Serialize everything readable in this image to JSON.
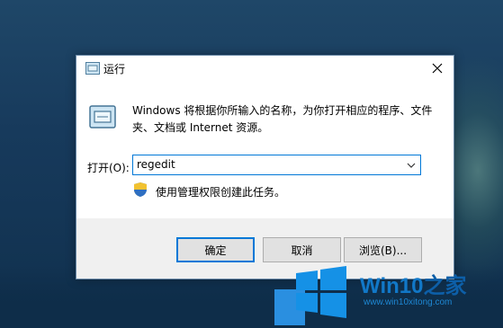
{
  "window": {
    "title": "运行",
    "description": "Windows 将根据你所输入的名称，为你打开相应的程序、文件夹、文档或 Internet 资源。",
    "open_label": "打开(O):",
    "open_value": "regedit",
    "admin_note": "使用管理权限创建此任务。"
  },
  "buttons": {
    "ok": "确定",
    "cancel": "取消",
    "browse": "浏览(B)..."
  },
  "watermark": {
    "brand_prefix": "Win10",
    "brand_suffix": "之家",
    "url": "www.win10xitong.com"
  },
  "colors": {
    "accent": "#0078d7",
    "brand": "#1178c8"
  }
}
